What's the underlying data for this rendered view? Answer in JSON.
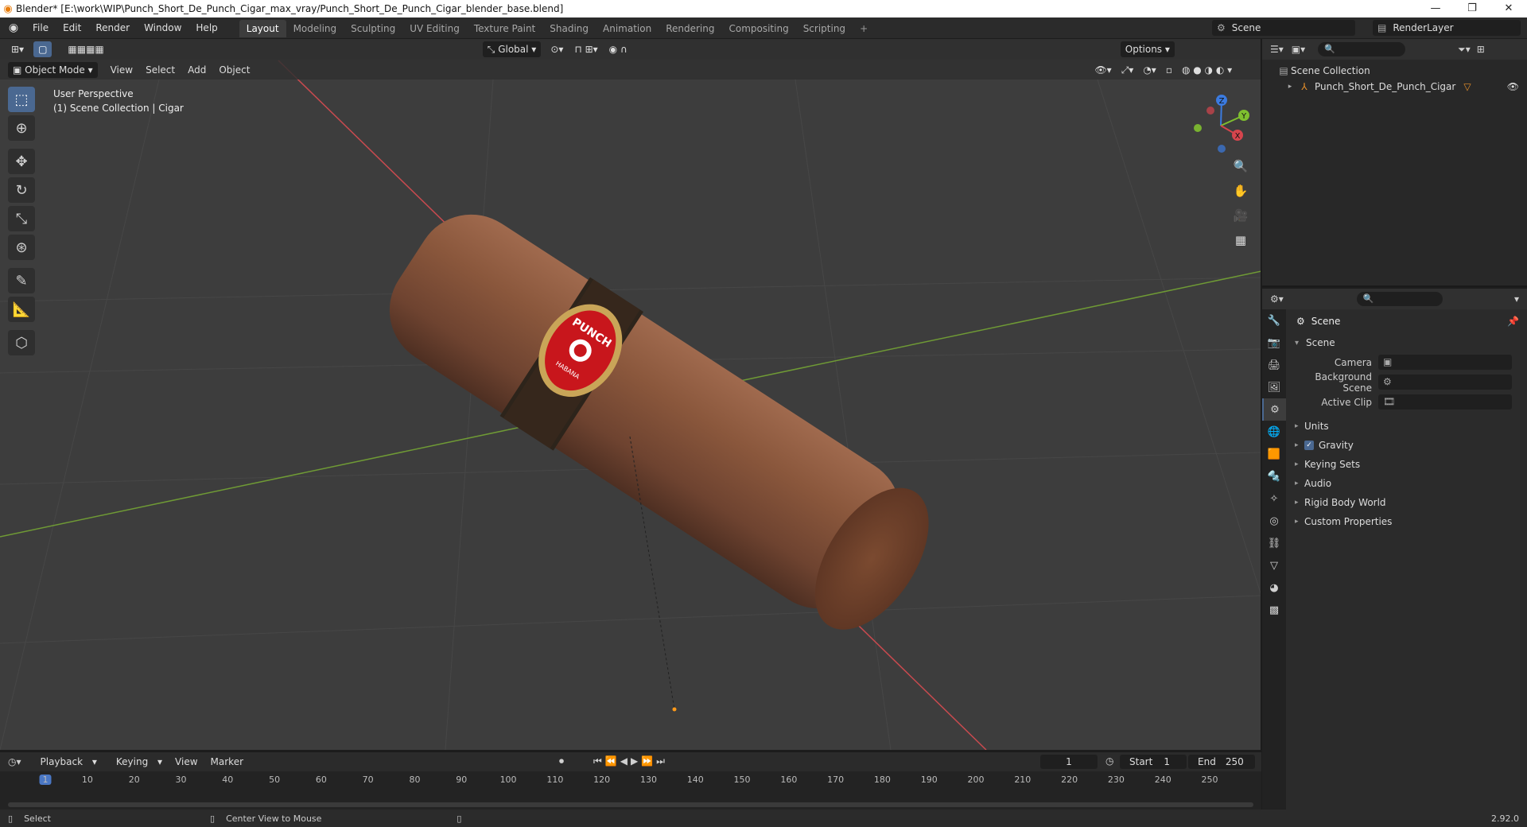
{
  "window": {
    "title": "Blender* [E:\\work\\WIP\\Punch_Short_De_Punch_Cigar_max_vray/Punch_Short_De_Punch_Cigar_blender_base.blend]",
    "controls": [
      "—",
      "❐",
      "✕"
    ]
  },
  "topbar": {
    "menus": [
      "File",
      "Edit",
      "Render",
      "Window",
      "Help"
    ],
    "workspaces": [
      "Layout",
      "Modeling",
      "Sculpting",
      "UV Editing",
      "Texture Paint",
      "Shading",
      "Animation",
      "Rendering",
      "Compositing",
      "Scripting"
    ],
    "active_workspace": "Layout",
    "add_tab": "+",
    "scene_name": "Scene",
    "render_layer": "RenderLayer"
  },
  "viewport": {
    "mode": "Object Mode",
    "menus": [
      "View",
      "Select",
      "Add",
      "Object"
    ],
    "transform_orientation": "Global",
    "options_label": "Options",
    "info_line1": "User Perspective",
    "info_line2": "(1) Scene Collection | Cigar",
    "label_text": "PUNCH",
    "label_subtext": "HABANA",
    "gizmo": {
      "z": "Z",
      "y": "Y",
      "x": "X"
    },
    "colors": {
      "x_axis": "#d6454d",
      "y_axis": "#7fbf2f",
      "z_axis": "#3b7be0"
    }
  },
  "outliner": {
    "root": "Scene Collection",
    "items": [
      {
        "label": "Punch_Short_De_Punch_Cigar"
      }
    ]
  },
  "properties": {
    "context_title": "Scene",
    "panel_title": "Scene",
    "fields": [
      {
        "label": "Camera",
        "value": ""
      },
      {
        "label": "Background Scene",
        "value": ""
      },
      {
        "label": "Active Clip",
        "value": ""
      }
    ],
    "subpanels": [
      "Units",
      "Gravity",
      "Keying Sets",
      "Audio",
      "Rigid Body World",
      "Custom Properties"
    ],
    "gravity_checked": true
  },
  "timeline": {
    "menus": [
      "Playback",
      "Keying",
      "View",
      "Marker"
    ],
    "current_frame": "1",
    "start_label": "Start",
    "start_value": "1",
    "end_label": "End",
    "end_value": "250",
    "ticks": [
      "1",
      "10",
      "20",
      "30",
      "40",
      "50",
      "60",
      "70",
      "80",
      "90",
      "100",
      "110",
      "120",
      "130",
      "140",
      "150",
      "160",
      "170",
      "180",
      "190",
      "200",
      "210",
      "220",
      "230",
      "240",
      "250"
    ]
  },
  "statusbar": {
    "left": "Select",
    "middle": "Center View to Mouse",
    "version": "2.92.0"
  }
}
